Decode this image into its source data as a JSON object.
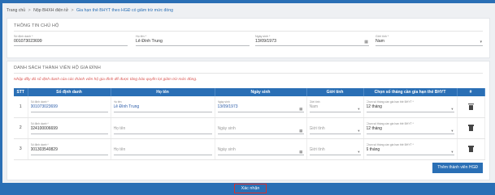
{
  "breadcrumb": {
    "home": "Trang chủ",
    "sep": ">",
    "level2": "Nộp BHXH điện tử",
    "current": "Gia hạn thẻ BHYT theo HGĐ có giảm trừ mức đóng"
  },
  "owner": {
    "section_title": "THÔNG TIN CHỦ HỘ",
    "id_label": "Số định danh *",
    "id_value": "001073023699",
    "name_label": "Họ tên *",
    "name_value": "Lê Đình Trung",
    "dob_label": "Ngày sinh *",
    "dob_value": "13/09/1973",
    "gender_label": "Giới tính *",
    "gender_value": "Nam"
  },
  "members": {
    "section_title": "DANH SÁCH THÀNH VIÊN HỘ GIA ĐÌNH",
    "notice": "Nhập đầy đủ số định danh của các thành viên hộ gia đình để được tăng bảo quyền lợi giảm trừ mức đóng.",
    "columns": [
      "STT",
      "Số định danh",
      "Họ tên",
      "Ngày sinh",
      "Giới tính",
      "Chọn số tháng cần gia hạn thẻ BHYT",
      "#"
    ],
    "cell_labels": {
      "id": "Số định danh *",
      "name": "Họ tên",
      "dob": "Ngày sinh",
      "gender": "Giới tính",
      "months": "Chọn số tháng cần gia hạn thẻ BHYT *"
    },
    "rows": [
      {
        "stt": "1",
        "id": "001073023699",
        "name": "Lê Đình Trung",
        "dob": "13/09/1973",
        "gender": "Nam",
        "months": "12 tháng"
      },
      {
        "stt": "2",
        "id": "024100006699",
        "name": "Họ tên",
        "dob": "Ngày sinh",
        "gender": "Giới tính",
        "months": "12 tháng"
      },
      {
        "stt": "3",
        "id": "001303540829",
        "name": "Họ tên",
        "dob": "Ngày sinh",
        "gender": "Giới tính",
        "months": "6 tháng"
      }
    ],
    "add_button": "Thêm thành viên HGĐ"
  },
  "confirm_button": "Xác nhận",
  "colors": {
    "primary": "#2a6fb5",
    "notice": "#d9534f",
    "highlight": "#d9302c"
  },
  "icons": {
    "calendar": "calendar-icon",
    "dropdown": "chevron-down-icon",
    "delete": "trash-icon"
  }
}
